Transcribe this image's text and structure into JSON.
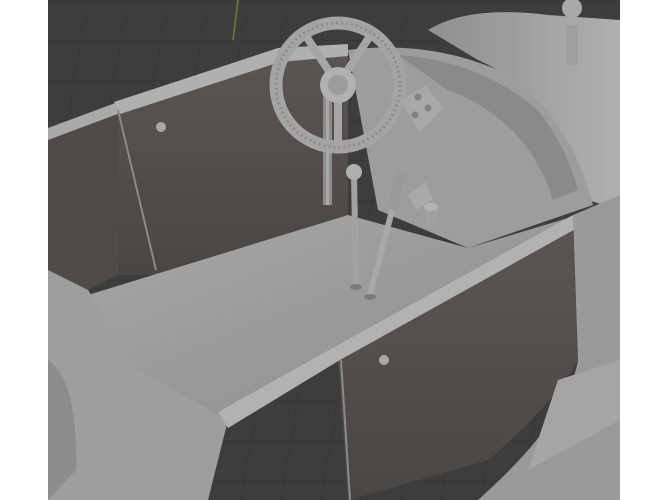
{
  "viewport": {
    "background_color": "#3d3d3d",
    "grid_color": "#353535",
    "axis_color": "#7a8a3a",
    "frame_color": "#ffffff"
  },
  "model": {
    "surface_color": "#9a9a9a",
    "light_color": "#b2b2b2",
    "shadow_color": "#4e4a48",
    "inner_wall_color": "#55504d",
    "rim_color": "#a4a4a4"
  },
  "icons": [
    "steering-wheel-icon",
    "gear-lever-icon",
    "hand-brake-icon",
    "pedal-icon",
    "gauge-cluster-icon"
  ]
}
